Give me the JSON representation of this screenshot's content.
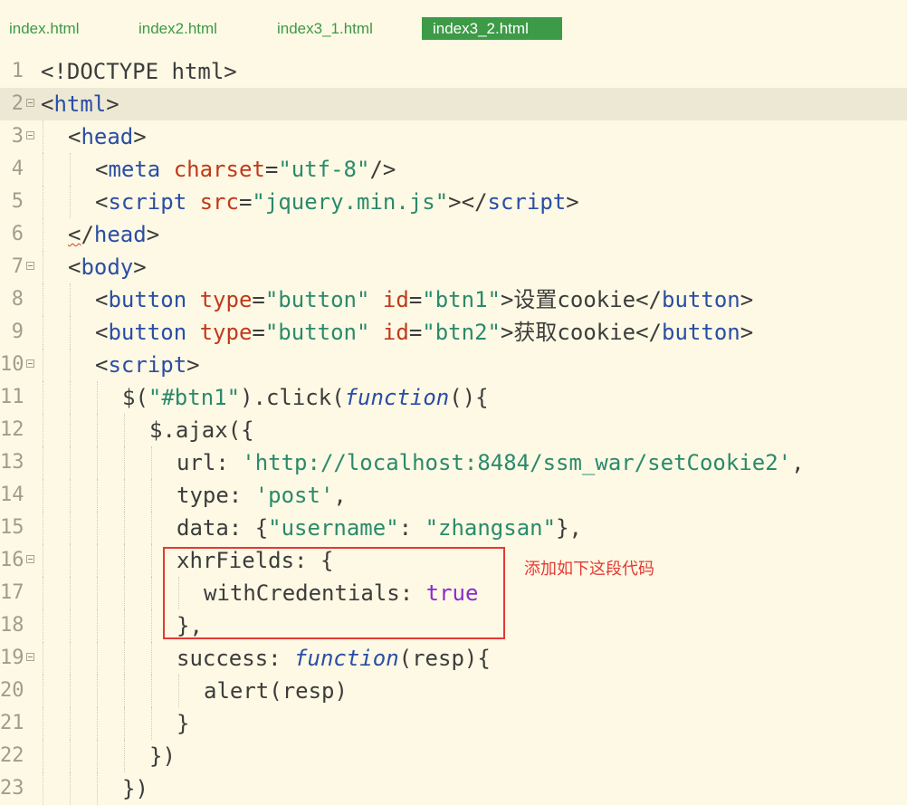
{
  "tabs": [
    {
      "label": "index.html",
      "active": false
    },
    {
      "label": "index2.html",
      "active": false
    },
    {
      "label": "index3_1.html",
      "active": false
    },
    {
      "label": "index3_2.html",
      "active": true
    }
  ],
  "annotation": {
    "text": "添加如下这段代码",
    "color": "#e53935"
  },
  "colors": {
    "background": "#fdf9e4",
    "tab_active": "#3d9a46",
    "current_line": "#ece8d3"
  },
  "lines": [
    {
      "n": "1",
      "fold": false,
      "indent": 0,
      "tokens": [
        [
          "pu",
          "<!DOCTYPE html>"
        ]
      ]
    },
    {
      "n": "2",
      "fold": true,
      "indent": 0,
      "current": true,
      "tokens": [
        [
          "pu",
          "<"
        ],
        [
          "tg",
          "html"
        ],
        [
          "pu",
          ">"
        ]
      ]
    },
    {
      "n": "3",
      "fold": true,
      "indent": 1,
      "tokens": [
        [
          "pu",
          "<"
        ],
        [
          "tg",
          "head"
        ],
        [
          "pu",
          ">"
        ]
      ]
    },
    {
      "n": "4",
      "fold": false,
      "indent": 2,
      "tokens": [
        [
          "pu",
          "<"
        ],
        [
          "tg",
          "meta "
        ],
        [
          "at",
          "charset"
        ],
        [
          "pu",
          "="
        ],
        [
          "st",
          "\"utf-8\""
        ],
        [
          "pu",
          "/>"
        ]
      ]
    },
    {
      "n": "5",
      "fold": false,
      "indent": 2,
      "tokens": [
        [
          "pu",
          "<"
        ],
        [
          "tg",
          "script "
        ],
        [
          "at",
          "src"
        ],
        [
          "pu",
          "="
        ],
        [
          "st",
          "\"jquery.min.js\""
        ],
        [
          "pu",
          "></"
        ],
        [
          "tg",
          "script"
        ],
        [
          "pu",
          ">"
        ]
      ]
    },
    {
      "n": "6",
      "fold": false,
      "indent": 1,
      "tokens": [
        [
          "squig",
          "<"
        ],
        [
          "pu",
          "/"
        ],
        [
          "tg",
          "head"
        ],
        [
          "pu",
          ">"
        ]
      ]
    },
    {
      "n": "7",
      "fold": true,
      "indent": 1,
      "tokens": [
        [
          "pu",
          "<"
        ],
        [
          "tg",
          "body"
        ],
        [
          "pu",
          ">"
        ]
      ]
    },
    {
      "n": "8",
      "fold": false,
      "indent": 2,
      "tokens": [
        [
          "pu",
          "<"
        ],
        [
          "tg",
          "button "
        ],
        [
          "at",
          "type"
        ],
        [
          "pu",
          "="
        ],
        [
          "st",
          "\"button\" "
        ],
        [
          "at",
          "id"
        ],
        [
          "pu",
          "="
        ],
        [
          "st",
          "\"btn1\""
        ],
        [
          "pu",
          ">设置cookie</"
        ],
        [
          "tg",
          "button"
        ],
        [
          "pu",
          ">"
        ]
      ]
    },
    {
      "n": "9",
      "fold": false,
      "indent": 2,
      "tokens": [
        [
          "pu",
          "<"
        ],
        [
          "tg",
          "button "
        ],
        [
          "at",
          "type"
        ],
        [
          "pu",
          "="
        ],
        [
          "st",
          "\"button\" "
        ],
        [
          "at",
          "id"
        ],
        [
          "pu",
          "="
        ],
        [
          "st",
          "\"btn2\""
        ],
        [
          "pu",
          ">获取cookie</"
        ],
        [
          "tg",
          "button"
        ],
        [
          "pu",
          ">"
        ]
      ]
    },
    {
      "n": "10",
      "fold": true,
      "indent": 2,
      "tokens": [
        [
          "pu",
          "<"
        ],
        [
          "tg",
          "script"
        ],
        [
          "pu",
          ">"
        ]
      ]
    },
    {
      "n": "11",
      "fold": false,
      "indent": 3,
      "tokens": [
        [
          "pu",
          "$("
        ],
        [
          "st",
          "\"#btn1\""
        ],
        [
          "pu",
          ").click("
        ],
        [
          "kw",
          "function"
        ],
        [
          "pu",
          "(){"
        ]
      ]
    },
    {
      "n": "12",
      "fold": false,
      "indent": 4,
      "tokens": [
        [
          "pu",
          "$.ajax({"
        ]
      ]
    },
    {
      "n": "13",
      "fold": false,
      "indent": 5,
      "tokens": [
        [
          "pu",
          "url: "
        ],
        [
          "st",
          "'http://localhost:8484/ssm_war/setCookie2'"
        ],
        [
          "pu",
          ","
        ]
      ]
    },
    {
      "n": "14",
      "fold": false,
      "indent": 5,
      "tokens": [
        [
          "pu",
          "type: "
        ],
        [
          "st",
          "'post'"
        ],
        [
          "pu",
          ","
        ]
      ]
    },
    {
      "n": "15",
      "fold": false,
      "indent": 5,
      "tokens": [
        [
          "pu",
          "data: {"
        ],
        [
          "st",
          "\"username\""
        ],
        [
          "pu",
          ": "
        ],
        [
          "st",
          "\"zhangsan\""
        ],
        [
          "pu",
          "},"
        ]
      ]
    },
    {
      "n": "16",
      "fold": true,
      "indent": 5,
      "tokens": [
        [
          "pu",
          "xhrFields: {"
        ]
      ]
    },
    {
      "n": "17",
      "fold": false,
      "indent": 6,
      "tokens": [
        [
          "pu",
          "withCredentials: "
        ],
        [
          "bo",
          "true"
        ]
      ]
    },
    {
      "n": "18",
      "fold": false,
      "indent": 5,
      "tokens": [
        [
          "pu",
          "},"
        ]
      ]
    },
    {
      "n": "19",
      "fold": true,
      "indent": 5,
      "tokens": [
        [
          "pu",
          "success: "
        ],
        [
          "kw",
          "function"
        ],
        [
          "pu",
          "(resp){"
        ]
      ]
    },
    {
      "n": "20",
      "fold": false,
      "indent": 6,
      "tokens": [
        [
          "pu",
          "alert(resp)"
        ]
      ]
    },
    {
      "n": "21",
      "fold": false,
      "indent": 5,
      "tokens": [
        [
          "pu",
          "}"
        ]
      ]
    },
    {
      "n": "22",
      "fold": false,
      "indent": 4,
      "tokens": [
        [
          "pu",
          "})"
        ]
      ]
    },
    {
      "n": "23",
      "fold": false,
      "indent": 3,
      "tokens": [
        [
          "pu",
          "})"
        ]
      ]
    }
  ]
}
